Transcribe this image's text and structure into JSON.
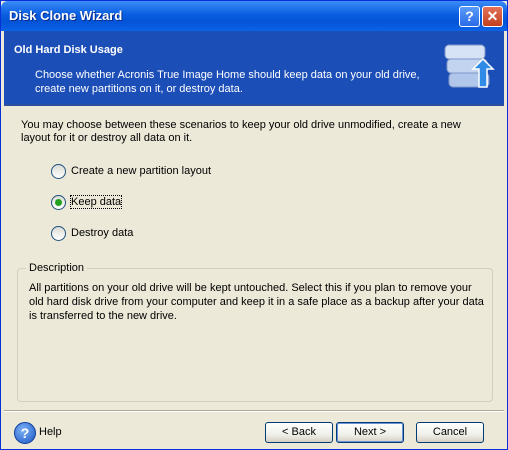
{
  "window": {
    "title": "Disk Clone Wizard",
    "help_glyph": "?",
    "close_glyph": "✕"
  },
  "header": {
    "title": "Old Hard Disk Usage",
    "description": "Choose whether Acronis True Image Home should keep data on your old drive, create new partitions on it, or destroy data.",
    "icon": "disk-clone-icon"
  },
  "intro": "You may choose between these scenarios to keep your old drive unmodified, create a new layout for it or destroy all data on it.",
  "options": [
    {
      "label": "Create a new partition layout",
      "selected": false
    },
    {
      "label": "Keep data",
      "selected": true
    },
    {
      "label": "Destroy data",
      "selected": false
    }
  ],
  "description": {
    "legend": "Description",
    "text": "All partitions on your old drive will be kept untouched. Select this if you plan to remove your old hard disk drive from your computer and keep it in a safe place as a backup after your data is transferred to the new drive."
  },
  "footer": {
    "help_label": "Help",
    "help_glyph": "?",
    "back_label": "< Back",
    "next_label": "Next >",
    "cancel_label": "Cancel"
  },
  "colors": {
    "titlebar": "#0a5ee0",
    "header_bg": "#1c4eb8",
    "dialog_bg": "#ece9d8",
    "selected_radio": "#21a121"
  }
}
